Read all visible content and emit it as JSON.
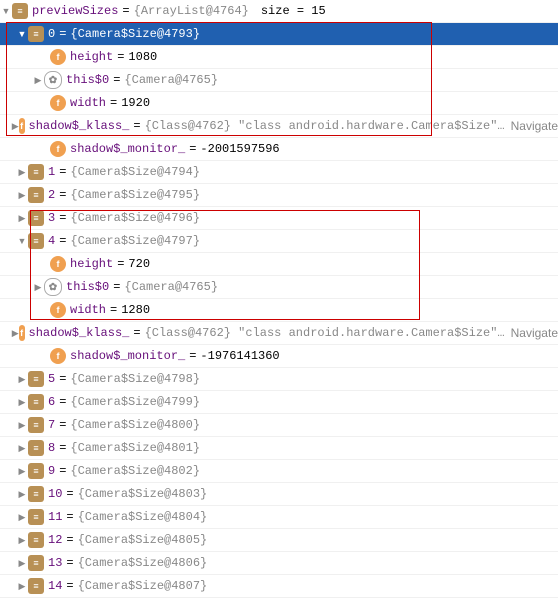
{
  "rootName": "previewSizes",
  "rootVal": "{ArrayList@4764}",
  "rootSize": "size = 15",
  "i0": {
    "name": "0",
    "val": "{Camera$Size@4793}",
    "height": {
      "n": "height",
      "v": "1080"
    },
    "this0": {
      "n": "this$0",
      "v": "{Camera@4765}"
    },
    "width": {
      "n": "width",
      "v": "1920"
    },
    "klass": {
      "n": "shadow$_klass_",
      "v": "{Class@4762} \"class android.hardware.Camera$Size\"…",
      "nav": "Navigate"
    },
    "mon": {
      "n": "shadow$_monitor_",
      "v": "-2001597596"
    }
  },
  "i1": {
    "n": "1",
    "v": "{Camera$Size@4794}"
  },
  "i2": {
    "n": "2",
    "v": "{Camera$Size@4795}"
  },
  "i3": {
    "n": "3",
    "v": "{Camera$Size@4796}"
  },
  "i4": {
    "name": "4",
    "val": "{Camera$Size@4797}",
    "height": {
      "n": "height",
      "v": "720"
    },
    "this0": {
      "n": "this$0",
      "v": "{Camera@4765}"
    },
    "width": {
      "n": "width",
      "v": "1280"
    },
    "klass": {
      "n": "shadow$_klass_",
      "v": "{Class@4762} \"class android.hardware.Camera$Size\"…",
      "nav": "Navigate"
    },
    "mon": {
      "n": "shadow$_monitor_",
      "v": "-1976141360"
    }
  },
  "i5": {
    "n": "5",
    "v": "{Camera$Size@4798}"
  },
  "i6": {
    "n": "6",
    "v": "{Camera$Size@4799}"
  },
  "i7": {
    "n": "7",
    "v": "{Camera$Size@4800}"
  },
  "i8": {
    "n": "8",
    "v": "{Camera$Size@4801}"
  },
  "i9": {
    "n": "9",
    "v": "{Camera$Size@4802}"
  },
  "i10": {
    "n": "10",
    "v": "{Camera$Size@4803}"
  },
  "i11": {
    "n": "11",
    "v": "{Camera$Size@4804}"
  },
  "i12": {
    "n": "12",
    "v": "{Camera$Size@4805}"
  },
  "i13": {
    "n": "13",
    "v": "{Camera$Size@4806}"
  },
  "i14": {
    "n": "14",
    "v": "{Camera$Size@4807}"
  }
}
